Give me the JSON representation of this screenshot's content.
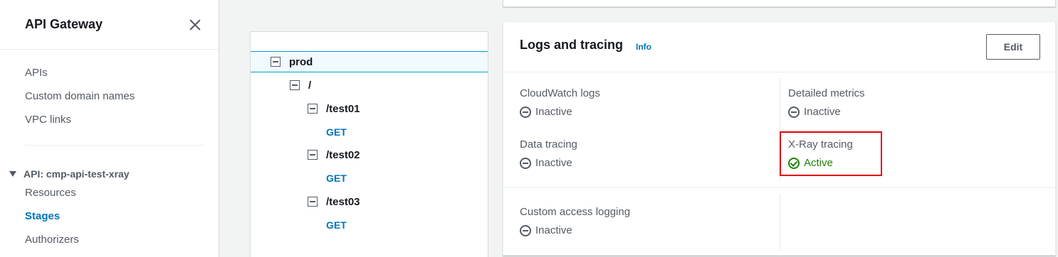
{
  "sidebar": {
    "title": "API Gateway",
    "close_icon": "close-icon",
    "top_links": [
      {
        "label": "APIs"
      },
      {
        "label": "Custom domain names"
      },
      {
        "label": "VPC links"
      }
    ],
    "section_label": "API: cmp-api-test-xray",
    "section_links": [
      {
        "label": "Resources"
      },
      {
        "label": "Stages"
      },
      {
        "label": "Authorizers"
      }
    ],
    "active_item": "Stages"
  },
  "tree": {
    "nodes": [
      {
        "label": "prod",
        "type": "stage",
        "selected": true
      },
      {
        "label": "/",
        "type": "resource"
      },
      {
        "label": "/test01",
        "type": "resource"
      },
      {
        "label": "GET",
        "type": "method"
      },
      {
        "label": "/test02",
        "type": "resource"
      },
      {
        "label": "GET",
        "type": "method"
      },
      {
        "label": "/test03",
        "type": "resource"
      },
      {
        "label": "GET",
        "type": "method"
      }
    ]
  },
  "logs_card": {
    "title": "Logs and tracing",
    "info_label": "Info",
    "edit_label": "Edit",
    "fields": {
      "cloudwatch_logs": {
        "label": "CloudWatch logs",
        "value": "Inactive"
      },
      "detailed_metrics": {
        "label": "Detailed metrics",
        "value": "Inactive"
      },
      "data_tracing": {
        "label": "Data tracing",
        "value": "Inactive"
      },
      "xray_tracing": {
        "label": "X-Ray tracing",
        "value": "Active"
      },
      "custom_access_logging": {
        "label": "Custom access logging",
        "value": "Inactive"
      }
    }
  },
  "colors": {
    "link_blue": "#0073bb",
    "active_green": "#1d8102",
    "highlight_red": "#e3000f",
    "muted_text": "#545b64"
  }
}
